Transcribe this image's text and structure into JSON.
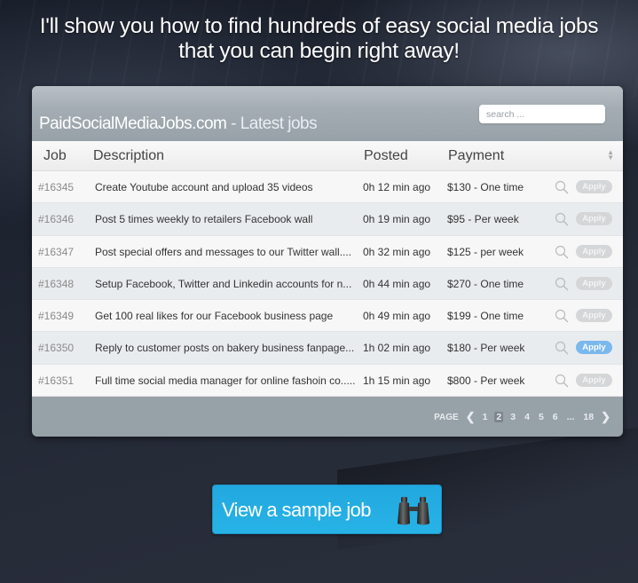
{
  "headline": {
    "line1": "I'll show you how to find hundreds of easy social media jobs",
    "line2": "that you can begin right away!"
  },
  "panel": {
    "site_name": "PaidSocialMediaJobs.com",
    "title_suffix": " - Latest jobs",
    "search_placeholder": "search ...",
    "columns": [
      "Job",
      "Description",
      "Posted",
      "Payment"
    ],
    "sort_icon": "sort-arrows-icon",
    "action_icon": "magnifier-icon",
    "apply_label": "Apply",
    "rows": [
      {
        "id": "#16345",
        "description": "Create Youtube account and upload 35 videos",
        "posted": "0h 12 min ago",
        "payment": "$130 - One time",
        "apply_active": false
      },
      {
        "id": "#16346",
        "description": "Post 5 times weekly to retailers Facebook wall",
        "posted": "0h 19 min ago",
        "payment": "$95  - Per week",
        "apply_active": false
      },
      {
        "id": "#16347",
        "description": "Post special offers and messages to our Twitter wall....",
        "posted": "0h 32 min ago",
        "payment": "$125 - per week",
        "apply_active": false
      },
      {
        "id": "#16348",
        "description": "Setup Facebook, Twitter and Linkedin accounts for n...",
        "posted": "0h 44 min ago",
        "payment": "$270 - One time",
        "apply_active": false
      },
      {
        "id": "#16349",
        "description": "Get 100 real likes for our Facebook business page",
        "posted": "0h 49 min ago",
        "payment": "$199 - One time",
        "apply_active": false
      },
      {
        "id": "#16350",
        "description": "Reply to customer posts on bakery business fanpage...",
        "posted": "1h 02 min ago",
        "payment": "$180 - Per week",
        "apply_active": true
      },
      {
        "id": "#16351",
        "description": "Full time social media manager for online fashoin co.....",
        "posted": "1h 15 min ago",
        "payment": "$800 - Per week",
        "apply_active": false
      }
    ],
    "pagination": {
      "label": "PAGE",
      "prev_icon": "chevron-left-icon",
      "next_icon": "chevron-right-icon",
      "pages": [
        "1",
        "2",
        "3",
        "4",
        "5",
        "6",
        "...",
        "18"
      ],
      "current": "2"
    }
  },
  "cta": {
    "label": "View a sample job",
    "icon": "binoculars-icon"
  },
  "colors": {
    "cta_blue": "#27b3e6",
    "apply_active": "#7ab8ee",
    "apply_inactive": "#d5d6d8",
    "panel_gray": "#97a1a8"
  }
}
